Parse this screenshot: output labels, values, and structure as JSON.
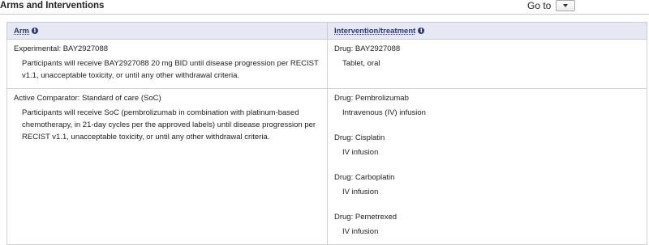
{
  "section": {
    "title": "Arms and Interventions",
    "goto_label": "Go to"
  },
  "table": {
    "headers": {
      "arm": "Arm",
      "intervention": "Intervention/treatment"
    },
    "rows": [
      {
        "arm_title": "Experimental: BAY2927088",
        "arm_description": "Participants will receive BAY2927088 20 mg BID until disease progression per RECIST v1.1, unacceptable toxicity, or until any other withdrawal criteria.",
        "drugs": [
          {
            "name": "Drug: BAY2927088",
            "route": "Tablet, oral"
          }
        ]
      },
      {
        "arm_title": "Active Comparator: Standard of care (SoC)",
        "arm_description": "Participants will receive SoC (pembrolizumab in combination with platinum-based chemotherapy, in 21-day cycles per the approved labels) until disease progression per RECIST v1.1, unacceptable toxicity, or until any other withdrawal criteria.",
        "drugs": [
          {
            "name": "Drug: Pembrolizumab",
            "route": "Intravenous (IV) infusion"
          },
          {
            "name": "Drug: Cisplatin",
            "route": "IV infusion"
          },
          {
            "name": "Drug: Carboplatin",
            "route": "IV infusion"
          },
          {
            "name": "Drug: Pemetrexed",
            "route": "IV infusion"
          }
        ]
      }
    ]
  },
  "icons": {
    "info": "info-icon",
    "dropdown": "chevron-down-icon"
  }
}
